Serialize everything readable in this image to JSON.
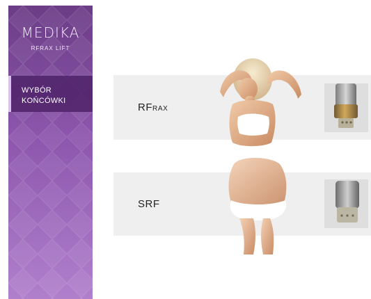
{
  "brand": {
    "logo_text": "MEDIKA",
    "subtitle_main": "RF",
    "subtitle_rest": "RAX LIFT"
  },
  "sidebar": {
    "items": [
      {
        "label_line1": "WYBÓR",
        "label_line2": "KOŃCÓWKI"
      }
    ]
  },
  "options": [
    {
      "title_big": "RF",
      "title_small": "RAX"
    },
    {
      "title_big": "SRF",
      "title_small": ""
    }
  ],
  "colors": {
    "sidebar_top": "#6b3d86",
    "sidebar_bottom": "#b080cc",
    "nav_active": "#4e2268",
    "card_bg": "#efefef",
    "text_dark": "#222222"
  }
}
